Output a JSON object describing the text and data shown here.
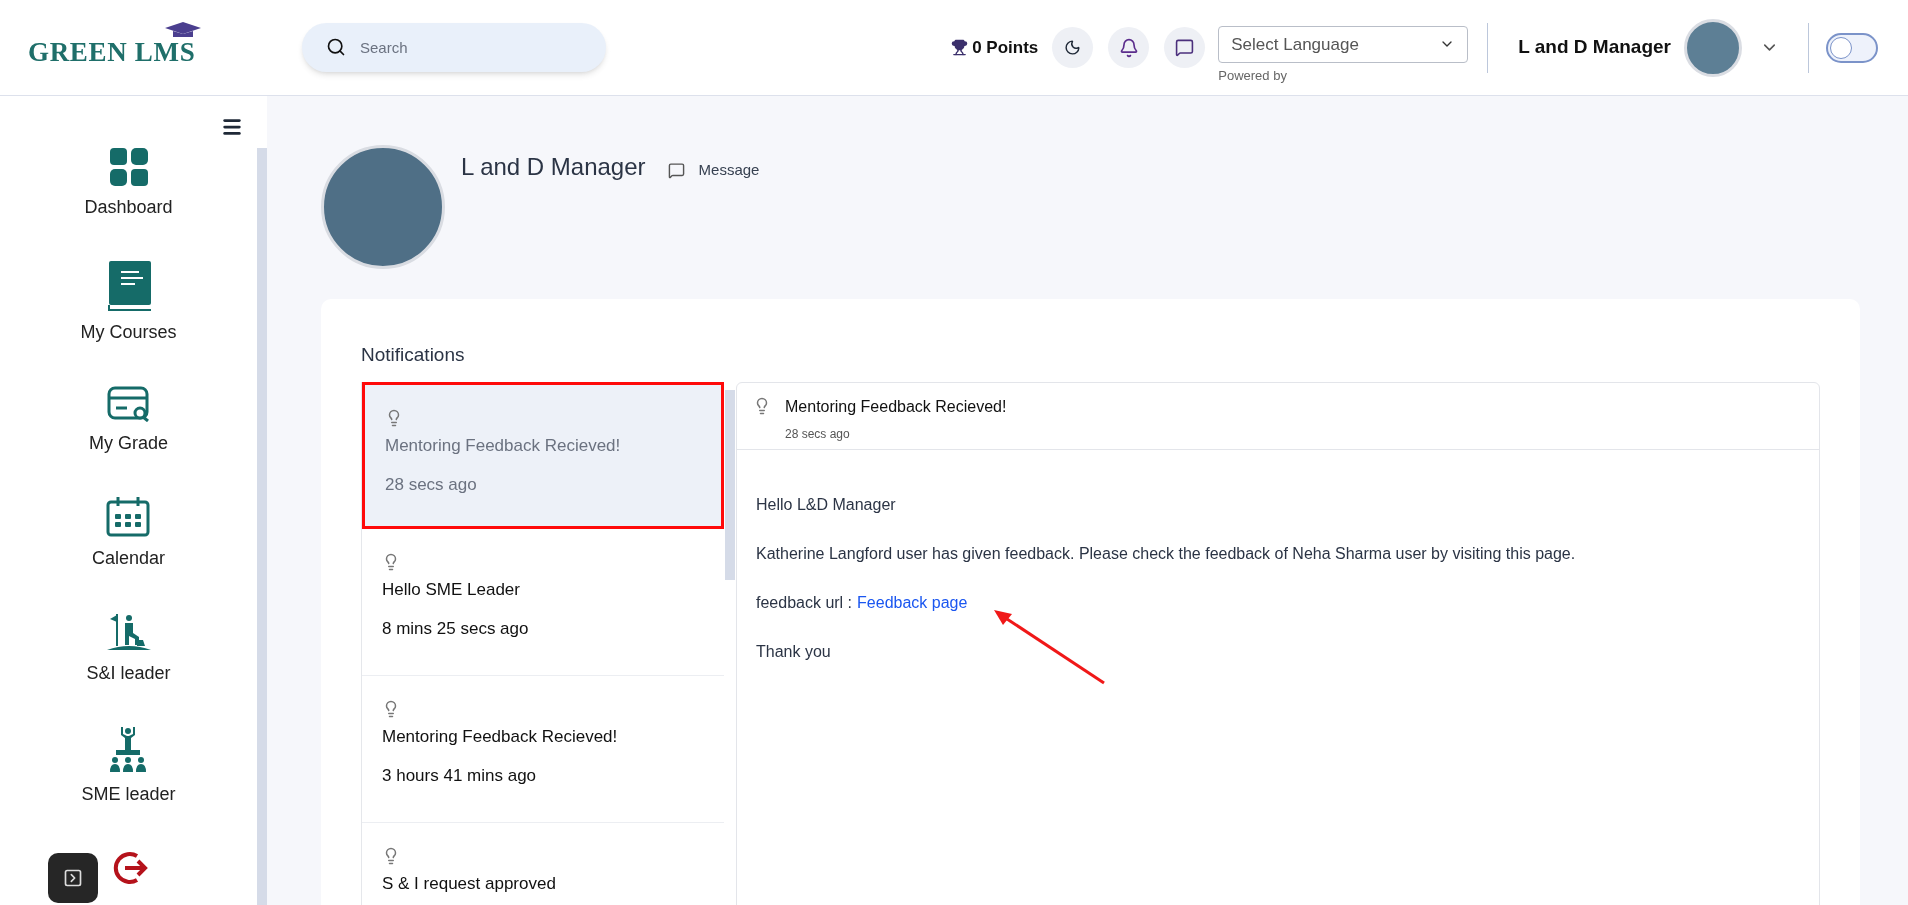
{
  "header": {
    "logo": "GREEN LMS",
    "search": {
      "placeholder": "Search"
    },
    "points": "0 Points",
    "language_select": {
      "value": "Select Language",
      "caption": "Powered by"
    },
    "user_name": "L and D Manager",
    "dark_mode_toggle": {
      "on": false
    }
  },
  "sidebar": {
    "items": [
      {
        "kind": "dashboard",
        "label": "Dashboard"
      },
      {
        "kind": "courses",
        "label": "My Courses"
      },
      {
        "kind": "grade",
        "label": "My Grade"
      },
      {
        "kind": "calendar",
        "label": "Calendar"
      },
      {
        "kind": "leader",
        "label": "S&I leader"
      },
      {
        "kind": "sme",
        "label": "SME leader"
      },
      {
        "kind": "logout"
      }
    ]
  },
  "profile": {
    "name": "L and D Manager",
    "message_link": "Message"
  },
  "notifications": {
    "title": "Notifications",
    "items": [
      {
        "title": "Mentoring Feedback Recieved!",
        "time": "28 secs ago",
        "selected": true
      },
      {
        "title": "Hello SME Leader",
        "time": "8 mins 25 secs ago",
        "selected": false
      },
      {
        "title": "Mentoring Feedback Recieved!",
        "time": "3 hours 41 mins ago",
        "selected": false
      },
      {
        "title": "S & I request approved",
        "selected": false
      }
    ],
    "detail": {
      "title": "Mentoring Feedback Recieved!",
      "time": "28 secs ago",
      "greeting": "Hello L&D Manager",
      "body": "Katherine Langford user has given feedback. Please check the feedback of Neha Sharma user by visiting this page.",
      "url_label": "feedback url :",
      "url_link": "Feedback page",
      "closing": "Thank you"
    }
  }
}
